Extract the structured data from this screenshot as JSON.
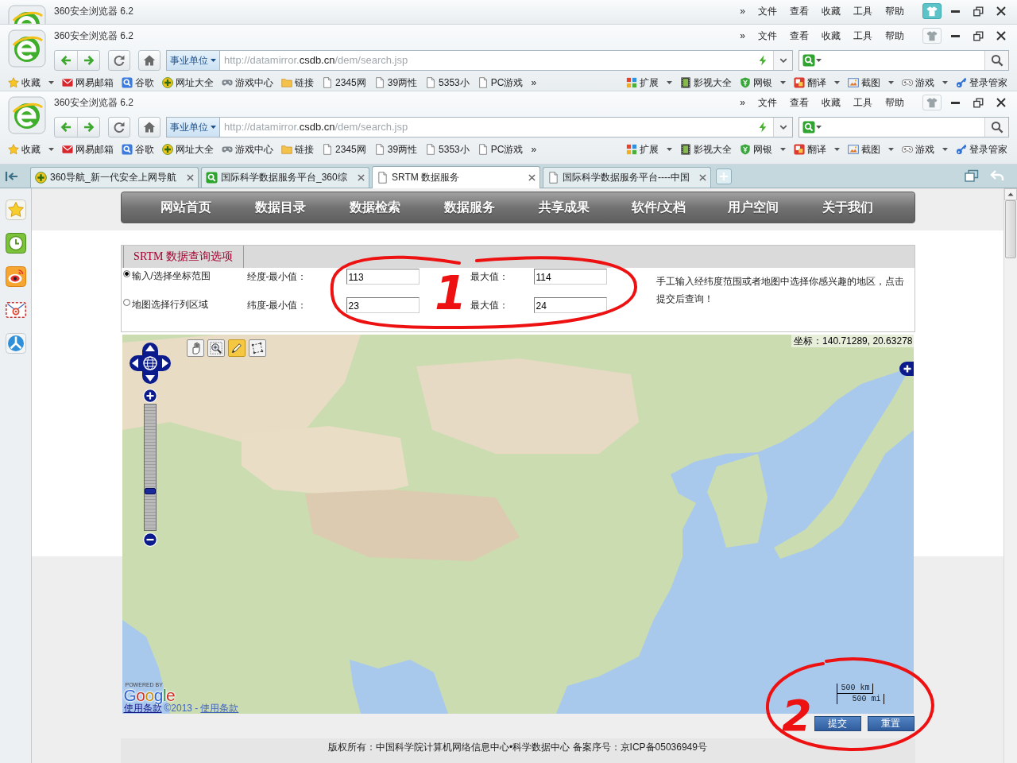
{
  "browser_windows": [
    {
      "title": "360安全浏览器 6.2",
      "active": true,
      "menu": [
        "»",
        "文件",
        "查看",
        "收藏",
        "工具",
        "帮助"
      ]
    },
    {
      "title": "360安全浏览器 6.2",
      "active": false,
      "menu": [
        "»",
        "文件",
        "查看",
        "收藏",
        "工具",
        "帮助"
      ],
      "address_bar": {
        "scope": "事业单位",
        "url": {
          "prefix": "http://datamirror.",
          "domain": "csdb.cn",
          "path": "/dem/search.jsp"
        }
      },
      "bookmarks": [
        {
          "kind": "favorites",
          "label": "收藏",
          "dropdown": true
        },
        {
          "kind": "mail",
          "label": "网易邮箱",
          "dropdown": false
        },
        {
          "kind": "search",
          "label": "谷歌",
          "dropdown": false
        },
        {
          "kind": "nav",
          "label": "网址大全",
          "dropdown": false
        },
        {
          "kind": "games",
          "label": "游戏中心",
          "dropdown": false
        },
        {
          "kind": "folder",
          "label": "链接",
          "dropdown": false
        },
        {
          "kind": "page",
          "label": "2345网",
          "dropdown": false
        },
        {
          "kind": "page",
          "label": "39两性",
          "dropdown": false
        },
        {
          "kind": "page",
          "label": "5353小",
          "dropdown": false
        },
        {
          "kind": "page",
          "label": "PC游戏",
          "dropdown": false
        },
        {
          "kind": "more",
          "label": "»",
          "dropdown": false
        }
      ],
      "tools": [
        {
          "kind": "apps",
          "label": "扩展",
          "dropdown": true
        },
        {
          "kind": "film",
          "label": "影视大全",
          "dropdown": false
        },
        {
          "kind": "bank",
          "label": "网银",
          "dropdown": true
        },
        {
          "kind": "translate",
          "label": "翻译",
          "dropdown": true
        },
        {
          "kind": "screenshot",
          "label": "截图",
          "dropdown": true
        },
        {
          "kind": "gamepad",
          "label": "游戏",
          "dropdown": true
        },
        {
          "kind": "key",
          "label": "登录管家",
          "dropdown": false
        }
      ]
    },
    {
      "title": "360安全浏览器 6.2",
      "active": false,
      "menu": [
        "»",
        "文件",
        "查看",
        "收藏",
        "工具",
        "帮助"
      ],
      "address_bar": {
        "scope": "事业单位",
        "url": {
          "prefix": "http://datamirror.",
          "domain": "csdb.cn",
          "path": "/dem/search.jsp"
        }
      },
      "bookmarks": [
        {
          "kind": "favorites",
          "label": "收藏",
          "dropdown": true
        },
        {
          "kind": "mail",
          "label": "网易邮箱",
          "dropdown": false
        },
        {
          "kind": "search",
          "label": "谷歌",
          "dropdown": false
        },
        {
          "kind": "nav",
          "label": "网址大全",
          "dropdown": false
        },
        {
          "kind": "games",
          "label": "游戏中心",
          "dropdown": false
        },
        {
          "kind": "folder",
          "label": "链接",
          "dropdown": false
        },
        {
          "kind": "page",
          "label": "2345网",
          "dropdown": false
        },
        {
          "kind": "page",
          "label": "39两性",
          "dropdown": false
        },
        {
          "kind": "page",
          "label": "5353小",
          "dropdown": false
        },
        {
          "kind": "page",
          "label": "PC游戏",
          "dropdown": false
        },
        {
          "kind": "more",
          "label": "»",
          "dropdown": false
        }
      ],
      "tools": [
        {
          "kind": "apps",
          "label": "扩展",
          "dropdown": true
        },
        {
          "kind": "film",
          "label": "影视大全",
          "dropdown": false
        },
        {
          "kind": "bank",
          "label": "网银",
          "dropdown": true
        },
        {
          "kind": "translate",
          "label": "翻译",
          "dropdown": true
        },
        {
          "kind": "screenshot",
          "label": "截图",
          "dropdown": true
        },
        {
          "kind": "gamepad",
          "label": "游戏",
          "dropdown": true
        },
        {
          "kind": "key",
          "label": "登录管家",
          "dropdown": false
        }
      ]
    }
  ],
  "tabs": [
    {
      "kind": "nav",
      "label": "360导航_新一代安全上网导航",
      "selected": false
    },
    {
      "kind": "search",
      "label": "国际科学数据服务平台_360综",
      "selected": false
    },
    {
      "kind": "page",
      "label": "SRTM 数据服务",
      "selected": true
    },
    {
      "kind": "page",
      "label": "国际科学数据服务平台----中国",
      "selected": false
    }
  ],
  "site_nav": [
    "网站首页",
    "数据目录",
    "数据检索",
    "数据服务",
    "共享成果",
    "软件/文档",
    "用户空间",
    "关于我们"
  ],
  "query_form": {
    "tab": "SRTM 数据查询选项",
    "modes": [
      {
        "label": "输入/选择坐标范围",
        "selected": true
      },
      {
        "label": "地图选择行列区域",
        "selected": false
      }
    ],
    "ranges": [
      {
        "label": "经度-最小值：",
        "min": "113",
        "max_label": "最大值：",
        "max": "114"
      },
      {
        "label": "纬度-最小值：",
        "min": "23",
        "max_label": "最大值：",
        "max": "24"
      }
    ],
    "hint": "手工输入经纬度范围或者地图中选择你感兴趣的地区，点击提交后查询！"
  },
  "map": {
    "coordinates": "坐标：140.71289, 20.63278",
    "zoom": {
      "level": 0.3
    },
    "tools": [
      {
        "kind": "pan",
        "selected": false
      },
      {
        "kind": "zoom_box",
        "selected": false
      },
      {
        "kind": "draw",
        "selected": true
      },
      {
        "kind": "polygon",
        "selected": false
      }
    ],
    "attribution": {
      "powered_by": "POWERED BY",
      "logo": "Google",
      "terms": "使用条款",
      "copyright": "©2013 -",
      "terms_alt": "使用条款"
    },
    "scale": {
      "metric": "500 km",
      "imperial": "500 mi"
    }
  },
  "buttons": [
    "提交",
    "重置"
  ],
  "footer": "版权所有：中国科学院计算机网络信息中心•科学数据中心 备案序号：京ICP备05036949号",
  "annotations": [
    {
      "label": "1"
    },
    {
      "label": "2"
    }
  ]
}
